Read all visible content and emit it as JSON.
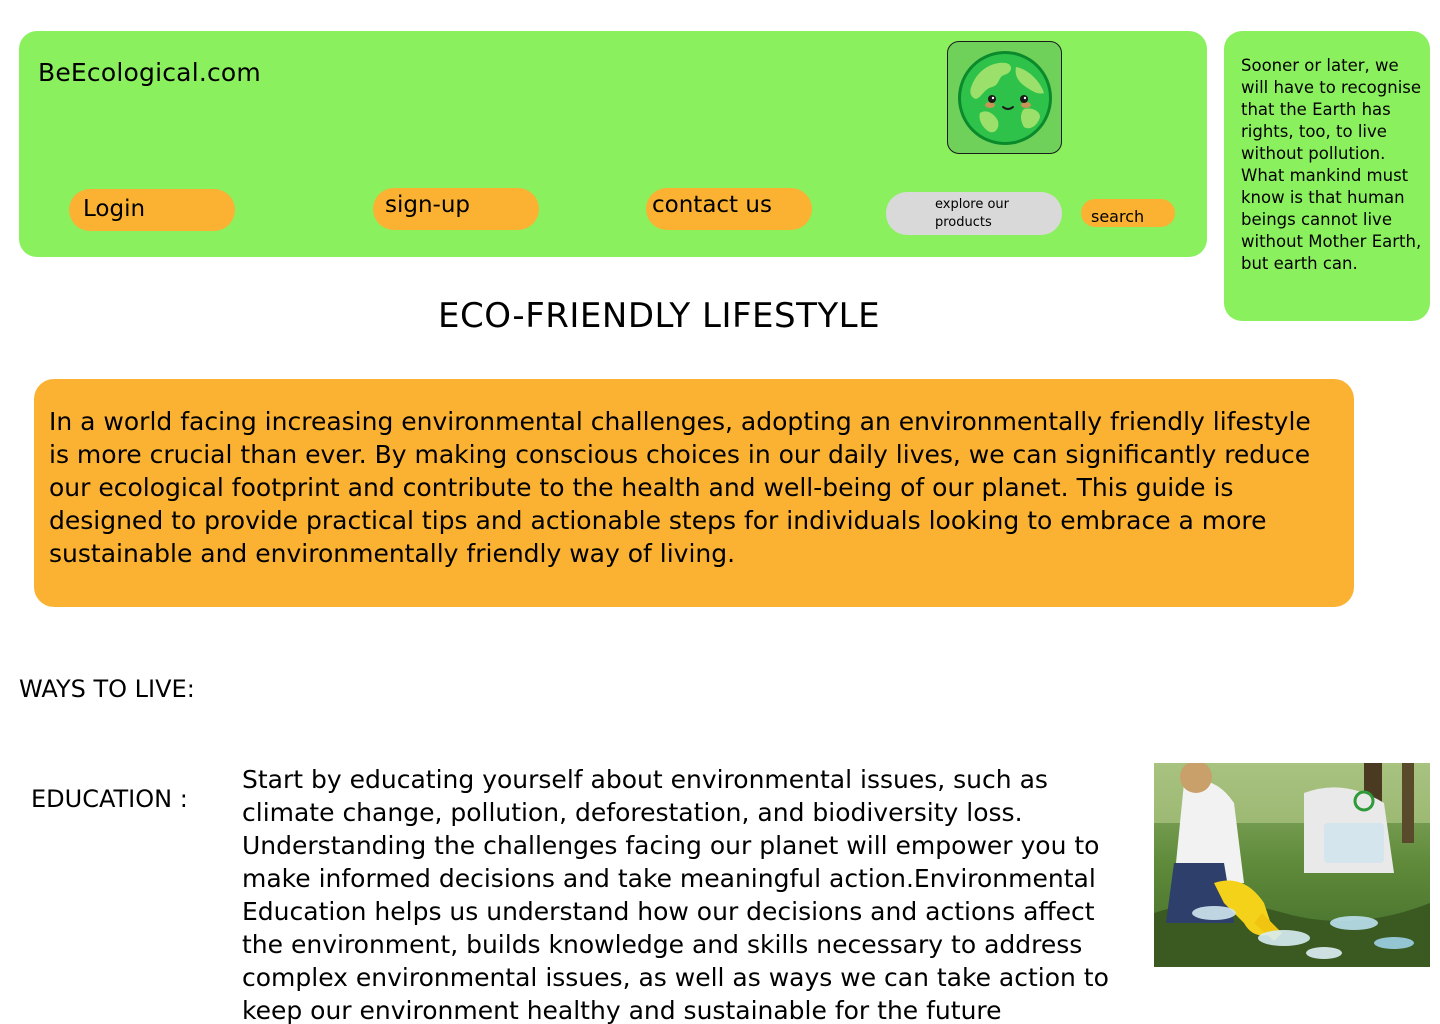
{
  "header": {
    "site_title": "BeEcological.com",
    "logo_icon": "earth-globe-icon",
    "nav": {
      "login": "Login",
      "signup": "sign-up",
      "contact": "contact us"
    },
    "explore_label": "explore our products",
    "search_label": "search"
  },
  "quote": {
    "text": "Sooner or later, we will have to recognise that the Earth has rights, too, to live without pollution. What mankind must know is that human beings cannot live without Mother Earth, but earth can."
  },
  "main": {
    "heading": "ECO-FRIENDLY LIFESTYLE",
    "intro": "In a world facing increasing environmental challenges, adopting an environmentally friendly lifestyle is more crucial than ever. By making conscious choices in our daily lives, we can significantly reduce our ecological footprint and contribute to the health and well-being of our planet. This guide is designed to provide practical tips and actionable steps for individuals looking to embrace a more sustainable and environmentally friendly way of living."
  },
  "ways": {
    "heading": "WAYS TO LIVE:",
    "education": {
      "label": "EDUCATION :",
      "text": "Start by educating yourself about environmental issues, such as climate change, pollution, deforestation, and biodiversity loss. Understanding the challenges facing our planet will empower you to make informed decisions and take meaningful action.Environmental Education helps us understand how our decisions and actions affect the environment, builds knowledge and skills necessary to address complex environmental issues, as well as ways we can take action to keep our environment healthy and sustainable for the future",
      "image_icon": "recycling-cleanup-photo"
    }
  },
  "colors": {
    "green_panel": "#8af05e",
    "orange_accent": "#fbb232",
    "grey_button": "#d9d9d9"
  }
}
